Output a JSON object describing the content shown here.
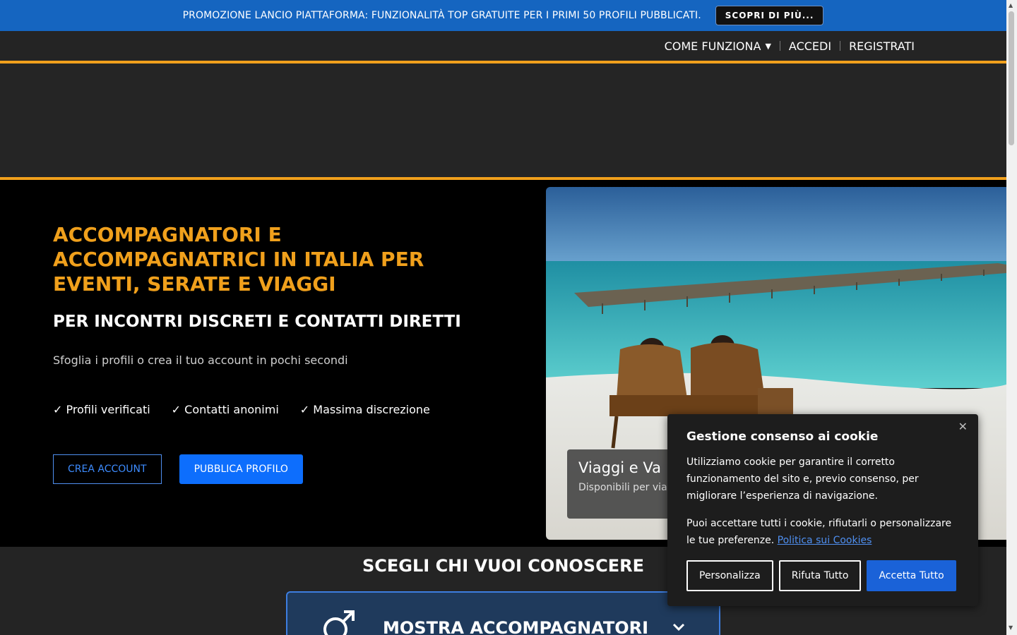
{
  "promo": {
    "text": "PROMOZIONE LANCIO PIATTAFORMA: FUNZIONALITÀ TOP GRATUITE PER I PRIMI 50 PROFILI PUBBLICATI.",
    "button": "SCOPRI DI PIÙ..."
  },
  "nav": {
    "how_it_works": "COME FUNZIONA",
    "login": "ACCEDI",
    "register": "REGISTRATI"
  },
  "hero": {
    "title": "ACCOMPAGNATORI E ACCOMPAGNATRICI IN ITALIA PER EVENTI, SERATE E VIAGGI",
    "subtitle": "PER INCONTRI DISCRETI E CONTATTI DIRETTI",
    "description": "Sfoglia i profili o crea il tuo account in pochi secondi",
    "features": [
      "✓ Profili verificati",
      "✓ Contatti anonimi",
      "✓ Massima discrezione"
    ],
    "create_account": "CREA ACCOUNT",
    "publish_profile": "PUBBLICA PROFILO"
  },
  "slide": {
    "title": "Viaggi e Va",
    "text": "Disponibili per viag"
  },
  "section": {
    "title": "SCEGLI CHI VUOI CONOSCERE",
    "accordion_label": "MOSTRA ACCOMPAGNATORI"
  },
  "cookie": {
    "title": "Gestione consenso ai cookie",
    "p1": "Utilizziamo cookie per garantire il corretto funzionamento del sito e, previo consenso, per migliorare l’esperienza di navigazione.",
    "p2": "Puoi accettare tutti i cookie, rifiutarli o personalizzare le tue preferenze.",
    "link": "Politica sui Cookies",
    "customize": "Personalizza",
    "reject": "Rifuta Tutto",
    "accept": "Accetta Tutto"
  },
  "colors": {
    "promo_bg": "#1565c0",
    "accent": "#f0a01c",
    "primary": "#0d6efd"
  },
  "icons": {
    "dropdown": "caret-down-icon",
    "close": "close-icon",
    "male": "male-symbol-icon",
    "expand": "chevron-down-icon"
  }
}
